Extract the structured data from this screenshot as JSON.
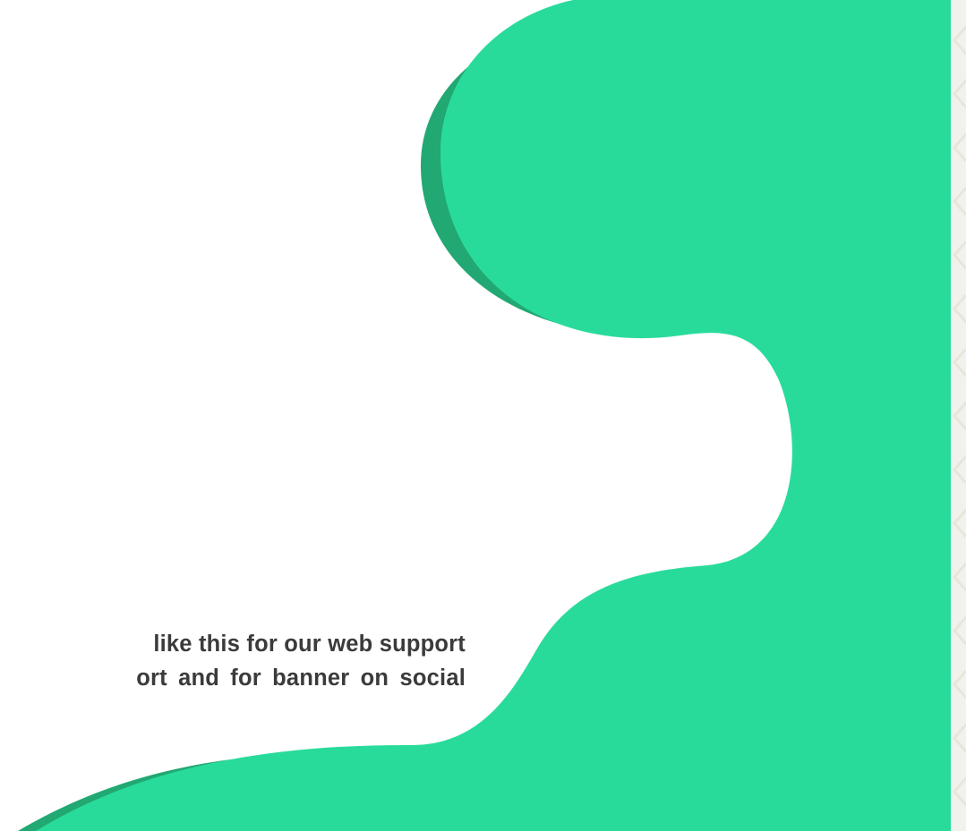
{
  "colors": {
    "background": "#ffffff",
    "blob_main": "#29db9b",
    "blob_shadow": "#22a872",
    "text": "#3b3b3b",
    "strip": "#f2f2ec",
    "strip_pattern": "#e6e6dc"
  },
  "caption": {
    "line1": "like this for our web support",
    "line2": "ort and for banner on social"
  }
}
